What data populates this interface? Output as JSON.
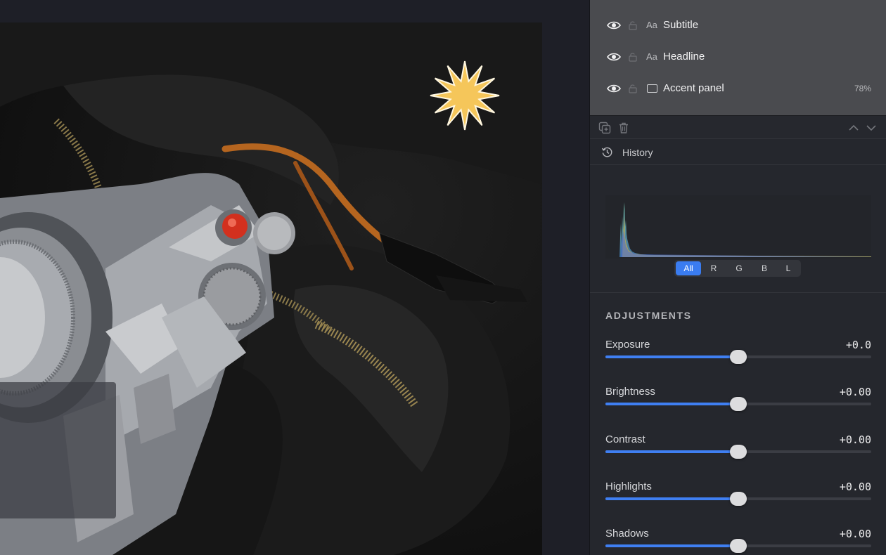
{
  "layers": [
    {
      "type": "text",
      "type_glyph": "Aa",
      "name": "Subtitle",
      "visible": true,
      "locked": false,
      "opacity": ""
    },
    {
      "type": "text",
      "type_glyph": "Aa",
      "name": "Headline",
      "visible": true,
      "locked": false,
      "opacity": ""
    },
    {
      "type": "shape",
      "type_glyph": "",
      "name": "Accent panel",
      "visible": true,
      "locked": false,
      "opacity": "78%"
    }
  ],
  "layer_toolbar": {
    "icons": [
      "duplicate-icon",
      "trash-icon",
      "chevron-up-icon",
      "chevron-down-icon"
    ]
  },
  "history": {
    "label": "History",
    "icon": "history-icon"
  },
  "histogram": {
    "channels": [
      "All",
      "R",
      "G",
      "B",
      "L"
    ],
    "active_channel": "All"
  },
  "adjustments": {
    "title": "ADJUSTMENTS",
    "items": [
      {
        "label": "Exposure",
        "value": "+0.0",
        "level": 0.5
      },
      {
        "label": "Brightness",
        "value": "+0.00",
        "level": 0.5
      },
      {
        "label": "Contrast",
        "value": "+0.00",
        "level": 0.5
      },
      {
        "label": "Highlights",
        "value": "+0.00",
        "level": 0.5
      },
      {
        "label": "Shadows",
        "value": "+0.00",
        "level": 0.5
      }
    ]
  },
  "colors": {
    "accent": "#3a7cf0",
    "star": "#f5c65a",
    "panel_bg": "#25272d",
    "layers_bg": "#4a4b4f"
  }
}
